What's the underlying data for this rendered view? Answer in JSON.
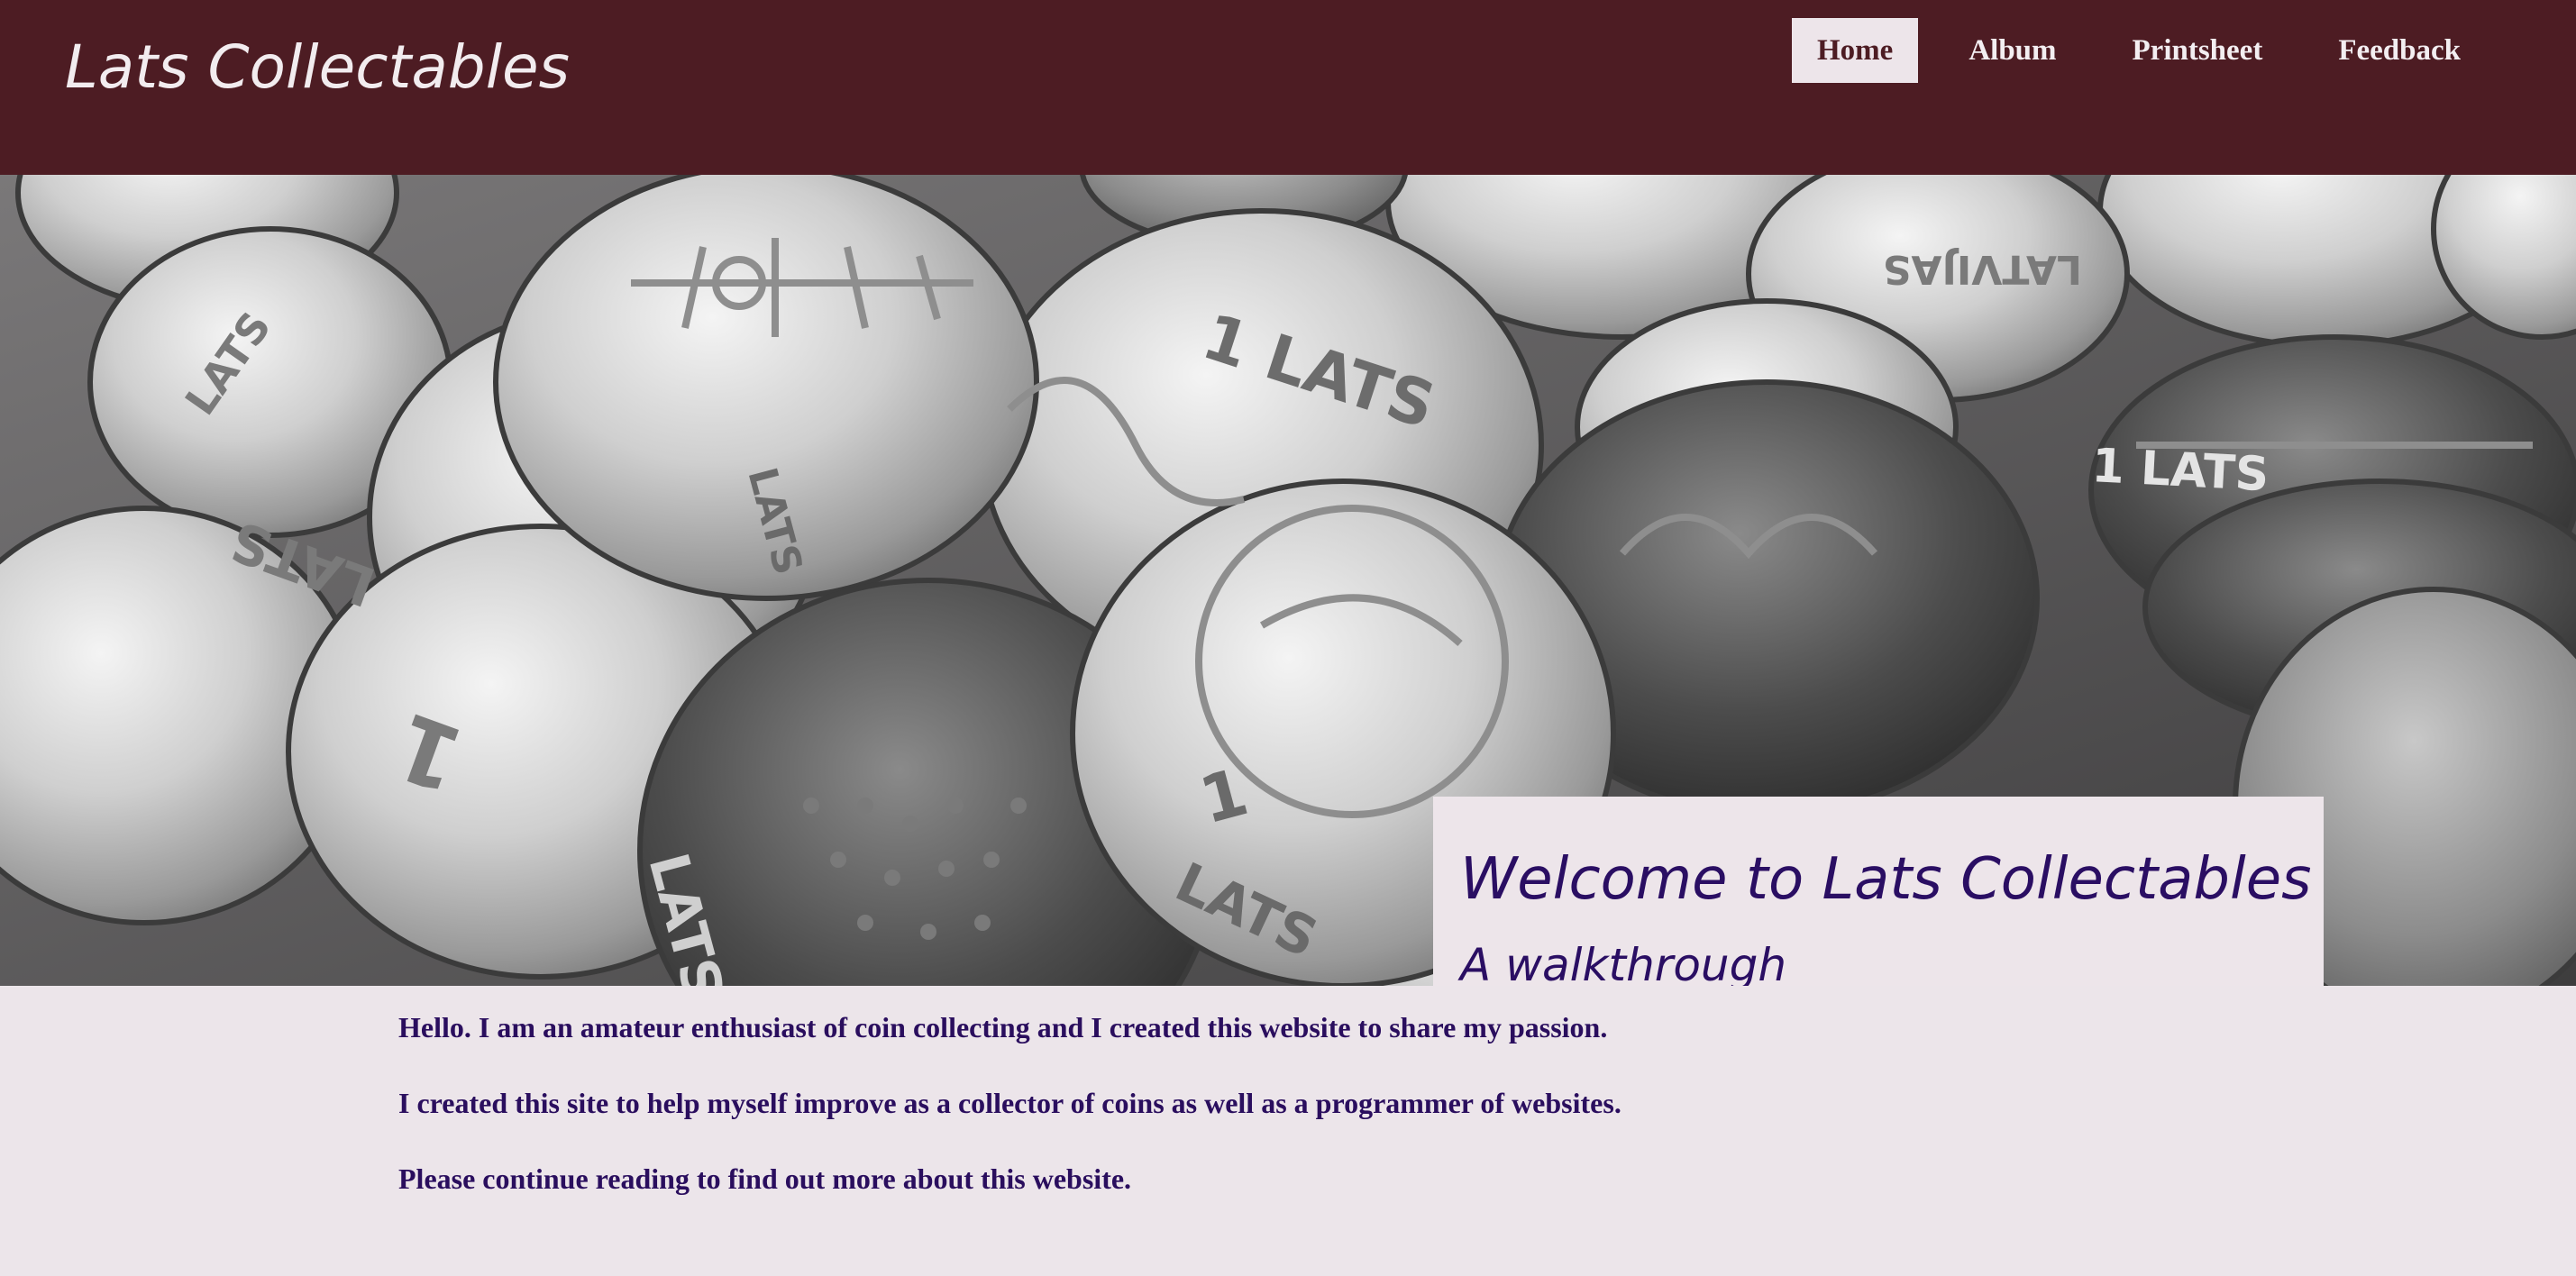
{
  "header": {
    "site_title": "Lats Collectables",
    "nav": [
      {
        "label": "Home",
        "active": true
      },
      {
        "label": "Album",
        "active": false
      },
      {
        "label": "Printsheet",
        "active": false
      },
      {
        "label": "Feedback",
        "active": false
      }
    ]
  },
  "hero": {
    "image": "coin-pile-photo",
    "coin_inscription": "LATS",
    "coin_denomination": "1",
    "coin_country": "LATVIJAS",
    "title": "Welcome to Lats Collectables",
    "subtitle": "A walkthrough"
  },
  "content": {
    "paragraphs": [
      "Hello. I am an amateur enthusiast of coin collecting and I created this website to share my passion.",
      "I created this site to help myself improve as a collector of coins as well as a programmer of websites.",
      "Please continue reading to find out more about this website."
    ]
  },
  "colors": {
    "header_bg": "#4d1c23",
    "page_bg": "#ece5ea",
    "accent_text": "#2a0e63"
  }
}
